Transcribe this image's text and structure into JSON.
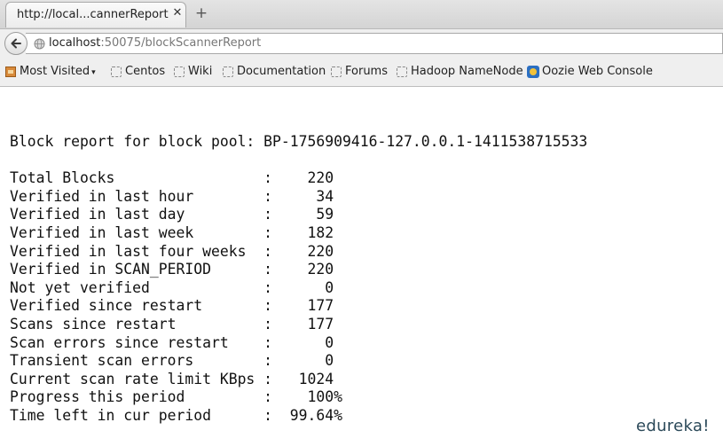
{
  "tab": {
    "title": "http://local...cannerReport",
    "close_glyph": "✕",
    "new_tab_glyph": "+"
  },
  "nav": {
    "url_host": "localhost",
    "url_path": ":50075/blockScannerReport"
  },
  "bookmarks": [
    {
      "label": "Most Visited",
      "icon": "most-visited-icon"
    },
    {
      "label": "Centos",
      "icon": "bookmark-icon"
    },
    {
      "label": "Wiki",
      "icon": "bookmark-icon"
    },
    {
      "label": "Documentation",
      "icon": "bookmark-icon"
    },
    {
      "label": "Forums",
      "icon": "bookmark-icon"
    },
    {
      "label": "Hadoop NameNode",
      "icon": "bookmark-icon"
    },
    {
      "label": "Oozie Web Console",
      "icon": "oozie-icon"
    }
  ],
  "report": {
    "heading": "Block report for block pool: BP-1756909416-127.0.0.1-1411538715533",
    "rows": [
      {
        "label": "Total Blocks",
        "value": "220"
      },
      {
        "label": "Verified in last hour",
        "value": "34"
      },
      {
        "label": "Verified in last day",
        "value": "59"
      },
      {
        "label": "Verified in last week",
        "value": "182"
      },
      {
        "label": "Verified in last four weeks",
        "value": "220"
      },
      {
        "label": "Verified in SCAN_PERIOD",
        "value": "220"
      },
      {
        "label": "Not yet verified",
        "value": "0"
      },
      {
        "label": "Verified since restart",
        "value": "177"
      },
      {
        "label": "Scans since restart",
        "value": "177"
      },
      {
        "label": "Scan errors since restart",
        "value": "0"
      },
      {
        "label": "Transient scan errors",
        "value": "0"
      },
      {
        "label": "Current scan rate limit KBps",
        "value": "1024"
      },
      {
        "label": "Progress this period",
        "value": "100%"
      },
      {
        "label": "Time left in cur period",
        "value": "99.64%"
      }
    ]
  },
  "watermark": "edureka!"
}
